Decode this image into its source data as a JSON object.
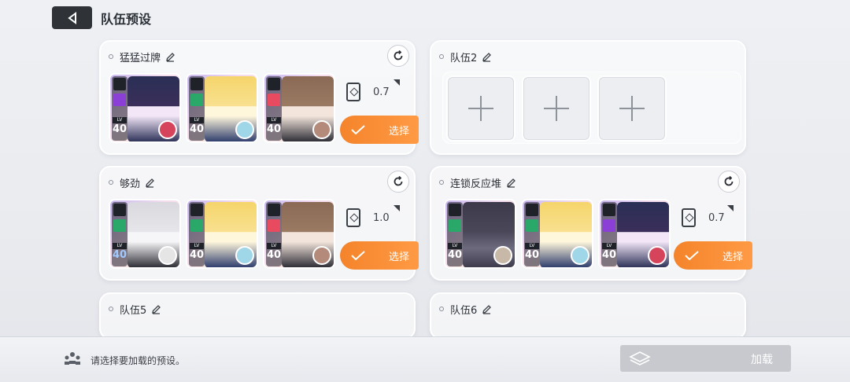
{
  "header": {
    "title": "队伍预设"
  },
  "teams": [
    {
      "name": "猛猛过牌",
      "cost": "0.7",
      "select_label": "选择",
      "chars": [
        {
          "level": "40",
          "class_color": "#8b3fd6",
          "art": [
            "#2a2f55",
            "#f2e6f7"
          ],
          "support": "#d6445c"
        },
        {
          "level": "40",
          "class_color": "#2aa86a",
          "art": [
            "#f5d56b",
            "#fff7dc"
          ],
          "support": "#9fd6e8"
        },
        {
          "level": "40",
          "class_color": "#e84a5f",
          "art": [
            "#8a6a55",
            "#f3e5dc"
          ],
          "support": "#b48a7a"
        }
      ]
    },
    {
      "name": "队伍2"
    },
    {
      "name": "够劲",
      "cost": "1.0",
      "select_label": "选择",
      "chars": [
        {
          "level": "40",
          "class_color": "#2aa86a",
          "art": [
            "#d8d8de",
            "#f6f6f8"
          ],
          "support": "#e5e5e5"
        },
        {
          "level": "40",
          "class_color": "#2aa86a",
          "art": [
            "#f5d56b",
            "#fff7dc"
          ],
          "support": "#9fd6e8"
        },
        {
          "level": "40",
          "class_color": "#e84a5f",
          "art": [
            "#8a6a55",
            "#f3e5dc"
          ],
          "support": "#b48a7a"
        }
      ]
    },
    {
      "name": "连锁反应堆",
      "cost": "0.7",
      "select_label": "选择",
      "chars": [
        {
          "level": "40",
          "class_color": "#2aa86a",
          "art": [
            "#3c3a4a",
            "#6d6a7e"
          ],
          "support": "#c7b8a8"
        },
        {
          "level": "40",
          "class_color": "#2aa86a",
          "art": [
            "#f5d56b",
            "#fff7dc"
          ],
          "support": "#9fd6e8"
        },
        {
          "level": "40",
          "class_color": "#8b3fd6",
          "art": [
            "#2a2f55",
            "#f2e6f7"
          ],
          "support": "#d6445c"
        }
      ]
    },
    {
      "name": "队伍5"
    },
    {
      "name": "队伍6"
    }
  ],
  "footer": {
    "hint": "请选择要加载的预设。",
    "load_label": "加载"
  }
}
